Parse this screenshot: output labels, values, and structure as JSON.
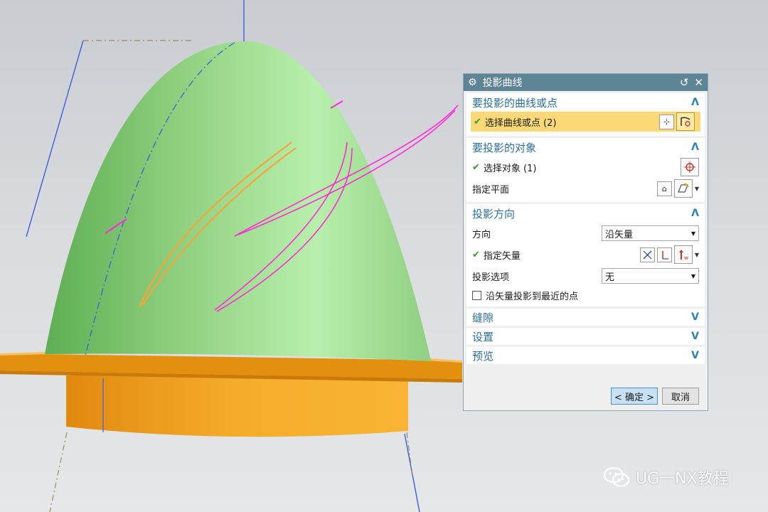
{
  "dialog": {
    "title": "投影曲线",
    "sections": {
      "curves": {
        "header": "要投影的曲线或点",
        "select_label": "选择曲线或点 (2)"
      },
      "target": {
        "header": "要投影的对象",
        "select_label": "选择对象 (1)",
        "plane_label": "指定平面"
      },
      "direction": {
        "header": "投影方向",
        "direction_label": "方向",
        "direction_value": "沿矢量",
        "vector_label": "指定矢量",
        "option_label": "投影选项",
        "option_value": "无",
        "nearest_label": "沿矢量投影到最近的点"
      },
      "gap": {
        "header": "缝隙"
      },
      "settings": {
        "header": "设置"
      },
      "preview": {
        "header": "预览"
      }
    },
    "ok_label": "< 确定 >",
    "cancel_label": "取消"
  },
  "watermark": "UG一NX教程",
  "colors": {
    "title_bar": "#5e8596",
    "section_header": "#2b6f9b",
    "selection_highlight": "#fbd977",
    "model_green": "#8fd07f",
    "flange_orange": "#f0a21e",
    "curve_magenta": "#ff2bd6",
    "curve_orange": "#f5a53a"
  },
  "icons": [
    "gear-icon",
    "reset-icon",
    "close-icon",
    "chevron-up-icon",
    "chevron-down-icon",
    "add-curve-icon",
    "curve-select-icon",
    "crosshair-icon",
    "plane-icon",
    "vector-cross-icon",
    "vector-axis-icon",
    "vector-arrow-icon",
    "wechat-icon"
  ]
}
